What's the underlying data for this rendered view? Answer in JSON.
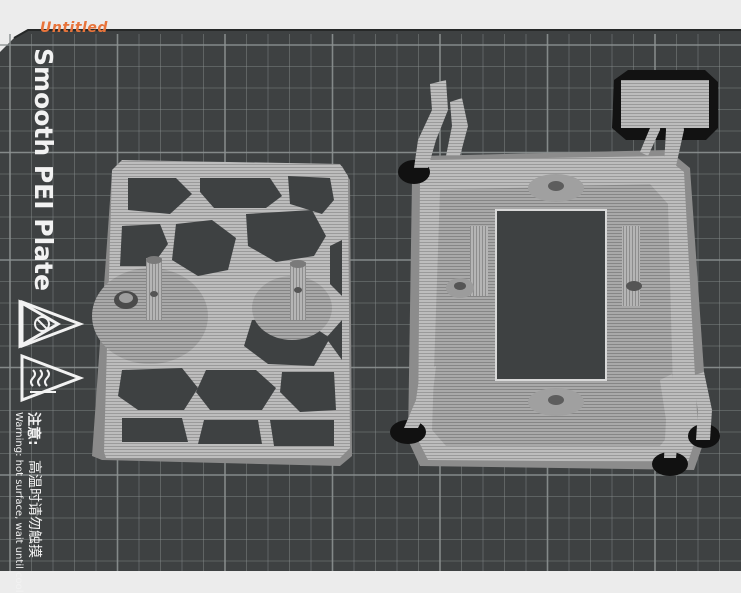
{
  "plate": {
    "title": "Untitled",
    "brand_text": "Smooth PEI Plate",
    "warning_label": "注意:",
    "warning_cn": "高温时请勿触摸",
    "warning_en": "Warning: hot surface, wait until cool"
  },
  "icons": {
    "no-touch": "no-touch-warning-icon",
    "hot": "hot-surface-warning-icon"
  },
  "colors": {
    "bed": "#3e4142",
    "grid": "#8c9191",
    "model": "#b9b9b9",
    "title": "#e8743b"
  }
}
